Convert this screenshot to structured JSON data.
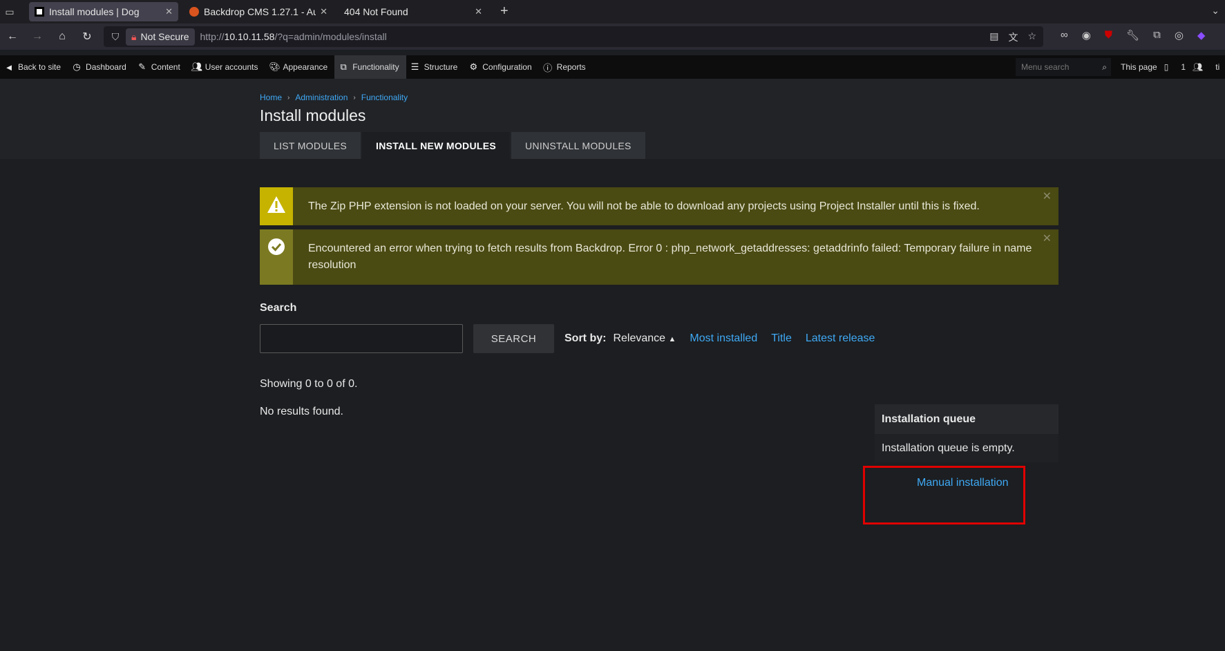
{
  "browser": {
    "tabs": [
      {
        "title": "Install modules | Dog",
        "active": true
      },
      {
        "title": "Backdrop CMS 1.27.1 - Aut",
        "active": false
      },
      {
        "title": "404 Not Found",
        "active": false
      }
    ],
    "new_tab": "+",
    "security_label": "Not Secure",
    "url_prefix": "http://",
    "url_host": "10.10.11.58",
    "url_path": "/?q=admin/modules/install"
  },
  "adminbar": {
    "items": [
      {
        "label": "Back to site",
        "icon": "arrow-left-circle-icon"
      },
      {
        "label": "Dashboard",
        "icon": "gauge-icon"
      },
      {
        "label": "Content",
        "icon": "pencil-icon"
      },
      {
        "label": "User accounts",
        "icon": "users-icon"
      },
      {
        "label": "Appearance",
        "icon": "palette-icon"
      },
      {
        "label": "Functionality",
        "icon": "puzzle-icon",
        "active": true
      },
      {
        "label": "Structure",
        "icon": "layers-icon"
      },
      {
        "label": "Configuration",
        "icon": "gear-icon"
      },
      {
        "label": "Reports",
        "icon": "info-icon"
      }
    ],
    "menu_search_placeholder": "Menu search",
    "this_page": "This page",
    "user_count": "1",
    "truncated_user": "ti"
  },
  "page": {
    "breadcrumb": [
      "Home",
      "Administration",
      "Functionality"
    ],
    "title": "Install modules",
    "tabs": [
      {
        "label": "LIST MODULES",
        "active": false
      },
      {
        "label": "INSTALL NEW MODULES",
        "active": true
      },
      {
        "label": "UNINSTALL MODULES",
        "active": false
      }
    ]
  },
  "messages": {
    "warning": "The Zip PHP extension is not loaded on your server. You will not be able to download any projects using Project Installer until this is fixed.",
    "error": "Encountered an error when trying to fetch results from Backdrop. Error 0 : php_network_getaddresses: getaddrinfo failed: Temporary failure in name resolution"
  },
  "search": {
    "label": "Search",
    "value": "",
    "button": "SEARCH",
    "sort_label": "Sort by:",
    "sort_current": "Relevance",
    "sort_options": [
      "Most installed",
      "Title",
      "Latest release"
    ]
  },
  "results": {
    "showing": "Showing 0 to 0 of 0.",
    "none": "No results found."
  },
  "queue": {
    "title": "Installation queue",
    "empty": "Installation queue is empty.",
    "manual_link": "Manual installation"
  },
  "colors": {
    "accent_link": "#3fa9f5",
    "highlight_box": "#e00000",
    "warning_icon_bg": "#c5b300"
  }
}
